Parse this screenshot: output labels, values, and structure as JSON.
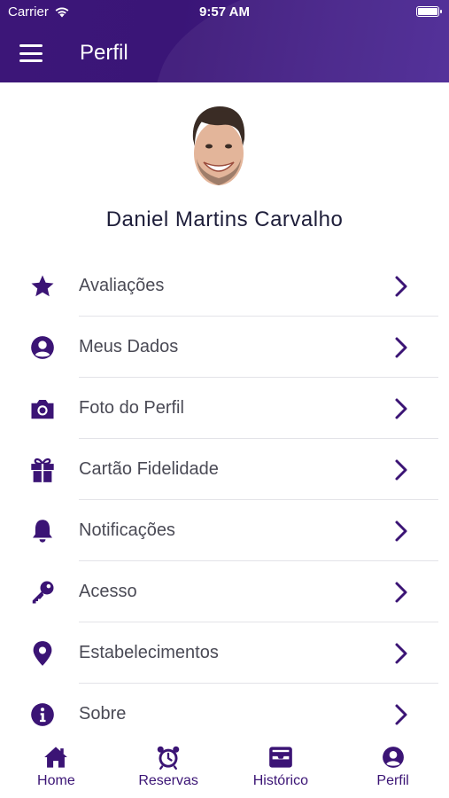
{
  "status_bar": {
    "carrier": "Carrier",
    "time": "9:57 AM"
  },
  "header": {
    "title": "Perfil"
  },
  "profile": {
    "name": "Daniel Martins Carvalho"
  },
  "menu": {
    "items": [
      {
        "label": "Avaliações",
        "icon": "star-icon"
      },
      {
        "label": "Meus Dados",
        "icon": "user-circle-icon"
      },
      {
        "label": "Foto do Perfil",
        "icon": "camera-icon"
      },
      {
        "label": "Cartão Fidelidade",
        "icon": "gift-icon"
      },
      {
        "label": "Notificações",
        "icon": "bell-icon"
      },
      {
        "label": "Acesso",
        "icon": "key-icon"
      },
      {
        "label": "Estabelecimentos",
        "icon": "map-pin-icon"
      },
      {
        "label": "Sobre",
        "icon": "info-icon"
      }
    ]
  },
  "tabbar": {
    "tabs": [
      {
        "label": "Home",
        "icon": "home-icon"
      },
      {
        "label": "Reservas",
        "icon": "alarm-clock-icon"
      },
      {
        "label": "Histórico",
        "icon": "inbox-icon"
      },
      {
        "label": "Perfil",
        "icon": "user-circle-icon"
      }
    ]
  },
  "colors": {
    "primary": "#3b1475",
    "text": "#4a4a55",
    "name_text": "#1e1e3a"
  }
}
